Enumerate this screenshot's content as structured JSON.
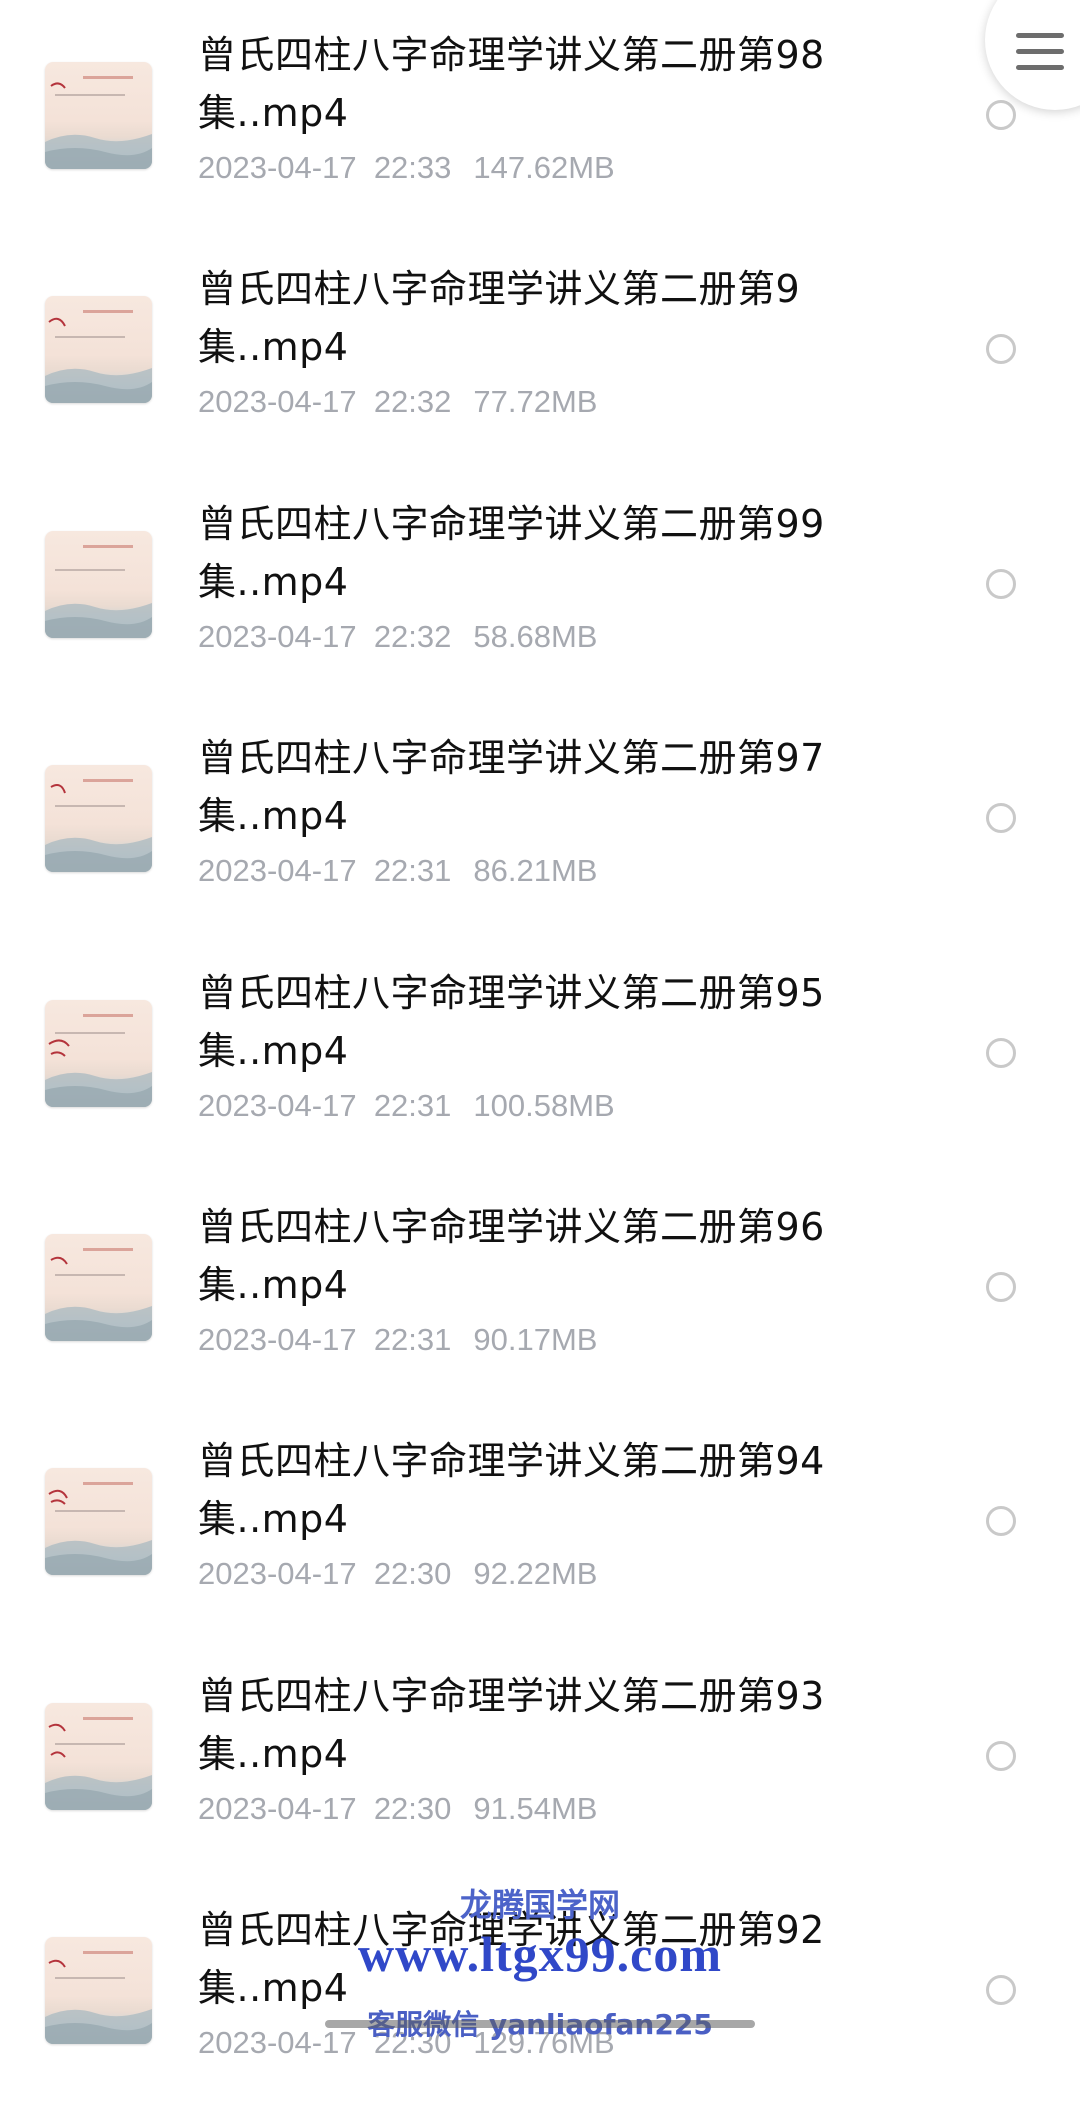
{
  "files": [
    {
      "name": "曾氏四柱八字命理学讲义第二册第98集..mp4",
      "date": "2023-04-17",
      "time": "22:33",
      "size": "147.62MB"
    },
    {
      "name": "曾氏四柱八字命理学讲义第二册第9集..mp4",
      "date": "2023-04-17",
      "time": "22:32",
      "size": "77.72MB"
    },
    {
      "name": "曾氏四柱八字命理学讲义第二册第99集..mp4",
      "date": "2023-04-17",
      "time": "22:32",
      "size": "58.68MB"
    },
    {
      "name": "曾氏四柱八字命理学讲义第二册第97集..mp4",
      "date": "2023-04-17",
      "time": "22:31",
      "size": "86.21MB"
    },
    {
      "name": "曾氏四柱八字命理学讲义第二册第95集..mp4",
      "date": "2023-04-17",
      "time": "22:31",
      "size": "100.58MB"
    },
    {
      "name": "曾氏四柱八字命理学讲义第二册第96集..mp4",
      "date": "2023-04-17",
      "time": "22:31",
      "size": "90.17MB"
    },
    {
      "name": "曾氏四柱八字命理学讲义第二册第94集..mp4",
      "date": "2023-04-17",
      "time": "22:30",
      "size": "92.22MB"
    },
    {
      "name": "曾氏四柱八字命理学讲义第二册第93集..mp4",
      "date": "2023-04-17",
      "time": "22:30",
      "size": "91.54MB"
    },
    {
      "name": "曾氏四柱八字命理学讲义第二册第92集..mp4",
      "date": "2023-04-17",
      "time": "22:30",
      "size": "129.76MB"
    }
  ],
  "icons": {
    "menu": "hamburger-menu-icon",
    "thumbnail": "video-thumbnail",
    "select": "radio-circle-icon"
  },
  "watermark": {
    "site_name": "龙腾国学网",
    "url": "www.ltgx99.com",
    "contact": "客服微信 yanliaofan225"
  },
  "colors": {
    "title_text": "#111111",
    "meta_text": "#a6a9b0",
    "radio_border": "#c9c9c9",
    "watermark": "#3048c8"
  }
}
